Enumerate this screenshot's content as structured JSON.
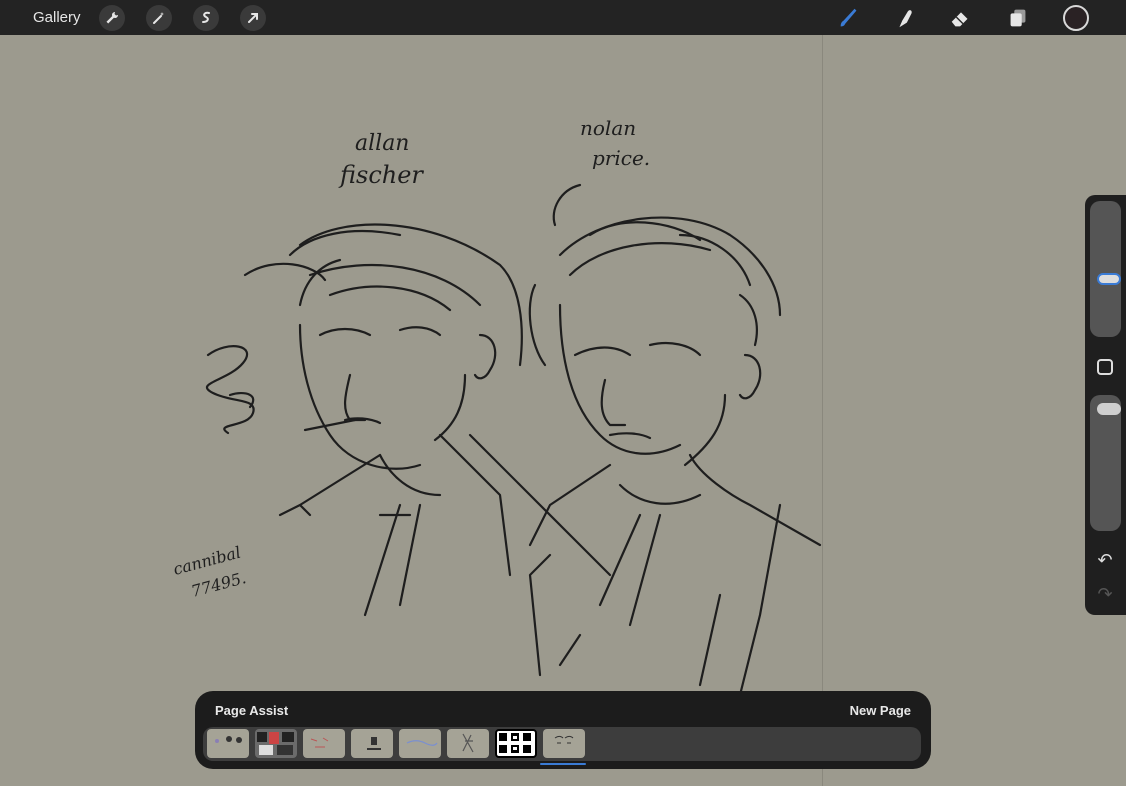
{
  "toolbar": {
    "gallery_label": "Gallery",
    "left_icons": [
      "wrench-icon",
      "magic-wand-icon",
      "selection-icon",
      "transform-arrow-icon"
    ],
    "right_icons": [
      "brush-icon",
      "smudge-icon",
      "eraser-icon",
      "layers-icon"
    ],
    "brush_color": "#3a7bd5",
    "current_color": "#2a2224"
  },
  "artwork": {
    "name_left_line1": "allan",
    "name_left_line2": "fischer",
    "name_right_line1": "nolan",
    "name_right_line2": "price.",
    "signature_line1": "cannibal",
    "signature_line2": "77495."
  },
  "sidebar": {
    "brush_size_level": 0.42,
    "opacity_level": 0.95,
    "modifier_icon": "square-icon",
    "undo_icon": "undo-icon",
    "redo_icon": "redo-icon"
  },
  "page_assist": {
    "title": "Page Assist",
    "new_page_label": "New Page",
    "thumbnail_count": 8,
    "active_index": 7
  }
}
